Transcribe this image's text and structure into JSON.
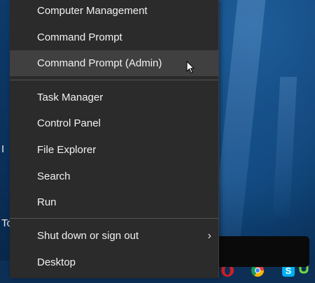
{
  "menu": {
    "items": [
      {
        "label": "Computer Management"
      },
      {
        "label": "Command Prompt"
      },
      {
        "label": "Command Prompt (Admin)"
      },
      {
        "label": "Task Manager"
      },
      {
        "label": "Control Panel"
      },
      {
        "label": "File Explorer"
      },
      {
        "label": "Search"
      },
      {
        "label": "Run"
      },
      {
        "label": "Shut down or sign out"
      },
      {
        "label": "Desktop"
      }
    ],
    "submenu_glyph": "›"
  },
  "desktop": {
    "edge_text_1": "I",
    "edge_text_2": "To"
  },
  "taskbar": {
    "icons": [
      "opera-icon",
      "chrome-icon",
      "skype-icon",
      "upwork-icon"
    ]
  },
  "colors": {
    "menu_bg": "#2b2b2b",
    "hover_bg": "#404040",
    "text": "#f2f2f2"
  }
}
